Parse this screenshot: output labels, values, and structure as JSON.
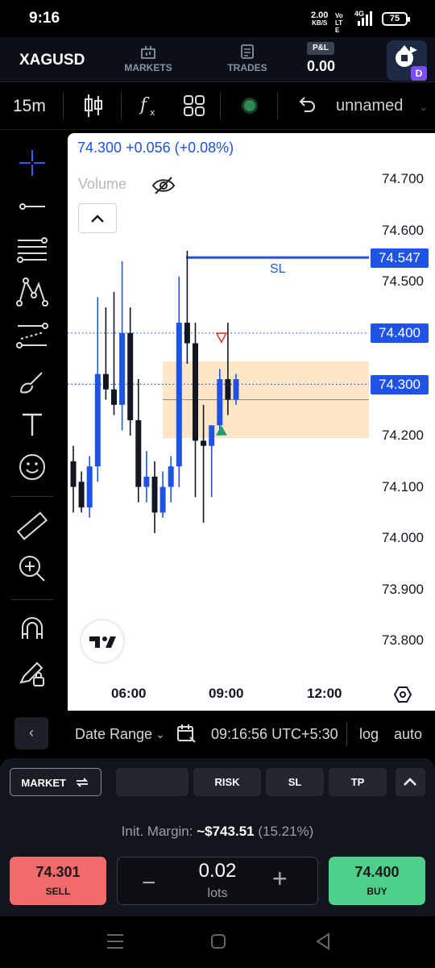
{
  "status_bar": {
    "time": "9:16",
    "net_speed": "2.00",
    "net_unit": "KB/S",
    "carrier": "Vo LTE",
    "network": "4G",
    "battery": "75"
  },
  "header": {
    "symbol": "XAGUSD",
    "markets_label": "MARKETS",
    "trades_label": "TRADES",
    "pnl_badge": "P&L",
    "pnl_value": "0.00",
    "avatar_badge": "D"
  },
  "toolbar": {
    "timeframe": "15m",
    "layout_name": "unnamed"
  },
  "chart": {
    "ohlc_price": "74.300",
    "ohlc_change": "+0.056 (+0.08%)",
    "volume_label": "Volume",
    "sl_label": "SL",
    "tags": {
      "sl_price": "74.547",
      "order_price": "74.400",
      "current_price": "74.300"
    },
    "time_labels": [
      "06:00",
      "09:00",
      "12:00"
    ],
    "accent_blue": "#1e53e5",
    "zone_color": "#fde5c7"
  },
  "chart_data": {
    "type": "candlestick",
    "y_ticks": [
      "74.700",
      "74.600",
      "74.500",
      "74.400",
      "74.300",
      "74.200",
      "74.100",
      "74.000",
      "73.900",
      "73.800"
    ],
    "ylim": [
      73.76,
      74.78
    ],
    "x_ticks": [
      "06:00",
      "09:00",
      "12:00"
    ],
    "lines": {
      "stop_loss": 74.547,
      "order_level": 74.4,
      "current_price": 74.3
    },
    "candles": [
      {
        "o": 74.15,
        "h": 74.18,
        "l": 74.05,
        "c": 74.1
      },
      {
        "o": 74.11,
        "h": 74.13,
        "l": 74.05,
        "c": 74.06
      },
      {
        "o": 74.06,
        "h": 74.16,
        "l": 74.04,
        "c": 74.14
      },
      {
        "o": 74.14,
        "h": 74.47,
        "l": 74.11,
        "c": 74.32
      },
      {
        "o": 74.32,
        "h": 74.45,
        "l": 74.27,
        "c": 74.29
      },
      {
        "o": 74.29,
        "h": 74.48,
        "l": 74.24,
        "c": 74.26
      },
      {
        "o": 74.26,
        "h": 74.54,
        "l": 74.21,
        "c": 74.4
      },
      {
        "o": 74.4,
        "h": 74.45,
        "l": 74.2,
        "c": 74.23
      },
      {
        "o": 74.23,
        "h": 74.31,
        "l": 74.07,
        "c": 74.1
      },
      {
        "o": 74.1,
        "h": 74.17,
        "l": 74.07,
        "c": 74.12
      },
      {
        "o": 74.12,
        "h": 74.15,
        "l": 74.01,
        "c": 74.05
      },
      {
        "o": 74.05,
        "h": 74.13,
        "l": 74.04,
        "c": 74.1
      },
      {
        "o": 74.1,
        "h": 74.16,
        "l": 74.07,
        "c": 74.14
      },
      {
        "o": 74.14,
        "h": 74.51,
        "l": 74.1,
        "c": 74.42
      },
      {
        "o": 74.42,
        "h": 74.56,
        "l": 74.34,
        "c": 74.38
      },
      {
        "o": 74.38,
        "h": 74.42,
        "l": 74.08,
        "c": 74.19
      },
      {
        "o": 74.19,
        "h": 74.26,
        "l": 74.03,
        "c": 74.18
      },
      {
        "o": 74.18,
        "h": 74.22,
        "l": 74.08,
        "c": 74.22
      },
      {
        "o": 74.22,
        "h": 74.33,
        "l": 74.2,
        "c": 74.31
      },
      {
        "o": 74.31,
        "h": 74.42,
        "l": 74.24,
        "c": 74.27
      },
      {
        "o": 74.27,
        "h": 74.32,
        "l": 74.26,
        "c": 74.31
      }
    ],
    "markers": [
      {
        "type": "sell",
        "candle": 19,
        "price": 74.39
      },
      {
        "type": "buy",
        "candle": 19,
        "price": 74.21
      }
    ],
    "zone": {
      "top": 74.345,
      "bottom": 74.195,
      "entry": 74.27
    }
  },
  "datebar": {
    "label": "Date Range",
    "time": "09:16:56 UTC+5:30",
    "log": "log",
    "auto": "auto"
  },
  "order": {
    "market_label": "MARKET",
    "risk_label": "RISK",
    "sl_label": "SL",
    "tp_label": "TP",
    "margin_prefix": "Init. Margin: ",
    "margin_value": "~$743.51",
    "margin_pct": "(15.21%)",
    "sell_price": "74.301",
    "sell_label": "SELL",
    "buy_price": "74.400",
    "buy_label": "BUY",
    "lots_value": "0.02",
    "lots_label": "lots",
    "sell_color": "#f26b6b",
    "buy_color": "#4fd08a"
  }
}
